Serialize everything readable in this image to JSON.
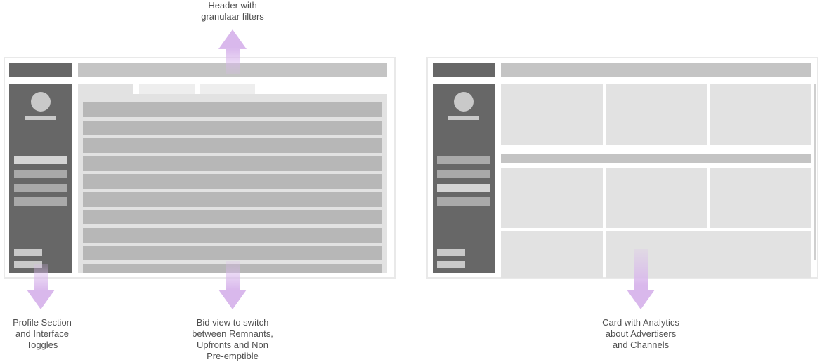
{
  "annotations": {
    "header": "Header with\ngranulaar filters",
    "profile": "Profile Section\nand Interface\nToggles",
    "bid_view": "Bid view to switch\nbetween Remnants,\nUpfronts and Non\nPre-emptible",
    "analytics": "Card with Analytics\nabout Advertisers\nand Channels"
  },
  "colors": {
    "sidebar": "#676767",
    "header_bar": "#c4c4c4",
    "row": "#b7b7b7",
    "panel": "#e2e2e2",
    "arrow": "#d9b8ec"
  }
}
